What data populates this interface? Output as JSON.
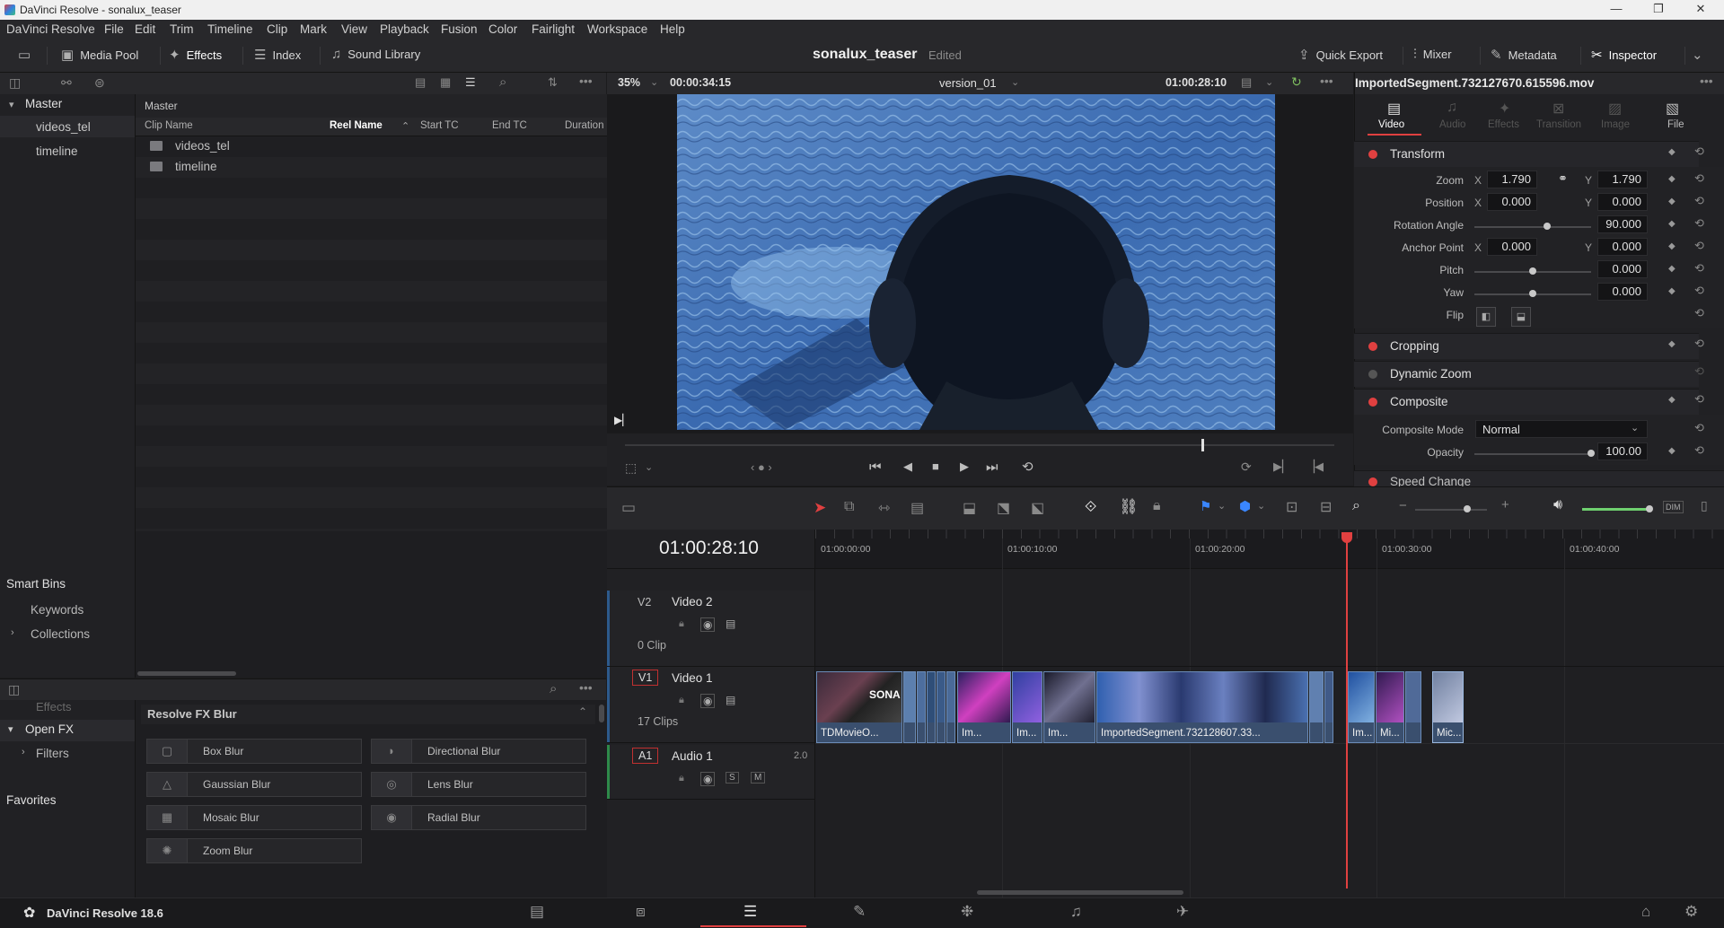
{
  "window": {
    "title": "DaVinci Resolve - sonalux_teaser",
    "minimize": "—",
    "maximize": "❐",
    "close": "✕"
  },
  "menu": [
    "DaVinci Resolve",
    "File",
    "Edit",
    "Trim",
    "Timeline",
    "Clip",
    "Mark",
    "View",
    "Playback",
    "Fusion",
    "Color",
    "Fairlight",
    "Workspace",
    "Help"
  ],
  "toolbar": {
    "media_pool": "Media Pool",
    "effects": "Effects",
    "index": "Index",
    "sound_library": "Sound Library",
    "project": "sonalux_teaser",
    "status": "Edited",
    "quick_export": "Quick Export",
    "mixer": "Mixer",
    "metadata": "Metadata",
    "inspector": "Inspector"
  },
  "bins": {
    "master": "Master",
    "items": [
      "videos_tel",
      "timeline"
    ],
    "smart_bins": "Smart Bins",
    "keywords": "Keywords",
    "collections": "Collections"
  },
  "media_pool": {
    "header": "Master",
    "columns": [
      "Clip Name",
      "Reel Name",
      "Start TC",
      "End TC",
      "Duration"
    ],
    "rows": [
      "videos_tel",
      "timeline"
    ]
  },
  "viewer": {
    "zoom": "35%",
    "duration_tc": "00:00:34:15",
    "timeline_name": "version_01",
    "current_tc": "01:00:28:10"
  },
  "inspector": {
    "clip_name": "ImportedSegment.732127670.615596.mov",
    "tabs": [
      "Video",
      "Audio",
      "Effects",
      "Transition",
      "Image",
      "File"
    ],
    "transform": {
      "title": "Transform",
      "zoom_label": "Zoom",
      "zoom_x": "1.790",
      "zoom_y": "1.790",
      "position_label": "Position",
      "pos_x": "0.000",
      "pos_y": "0.000",
      "rotation_label": "Rotation Angle",
      "rotation": "90.000",
      "anchor_label": "Anchor Point",
      "anchor_x": "0.000",
      "anchor_y": "0.000",
      "pitch_label": "Pitch",
      "pitch": "0.000",
      "yaw_label": "Yaw",
      "yaw": "0.000",
      "flip_label": "Flip",
      "x": "X",
      "y": "Y"
    },
    "cropping": "Cropping",
    "dynamic_zoom": "Dynamic Zoom",
    "composite": {
      "title": "Composite",
      "mode_label": "Composite Mode",
      "mode": "Normal",
      "opacity_label": "Opacity",
      "opacity": "100.00"
    },
    "speed_change": "Speed Change"
  },
  "effects": {
    "effects": "Effects",
    "open_fx": "Open FX",
    "filters": "Filters",
    "favorites": "Favorites",
    "group": "Resolve FX Blur",
    "items": [
      "Box Blur",
      "Directional Blur",
      "Gaussian Blur",
      "Lens Blur",
      "Mosaic Blur",
      "Radial Blur",
      "Zoom Blur"
    ]
  },
  "timeline": {
    "timecode": "01:00:28:10",
    "ruler": [
      "01:00:00:00",
      "01:00:10:00",
      "01:00:20:00",
      "01:00:30:00",
      "01:00:40:00"
    ],
    "tracks": [
      {
        "id": "V2",
        "name": "Video 2",
        "count": "0 Clip"
      },
      {
        "id": "V1",
        "name": "Video 1",
        "count": "17 Clips"
      },
      {
        "id": "A1",
        "name": "Audio 1",
        "level": "2.0"
      }
    ],
    "clips": [
      "TDMovieO...",
      "Im...",
      "Im...",
      "Im...",
      "ImportedSegment.732128607.33...",
      "Im...",
      "Mi...",
      "Mic..."
    ],
    "solo": "S",
    "mute": "M",
    "dim": "DIM"
  },
  "footer": {
    "app": "DaVinci Resolve 18.6"
  }
}
